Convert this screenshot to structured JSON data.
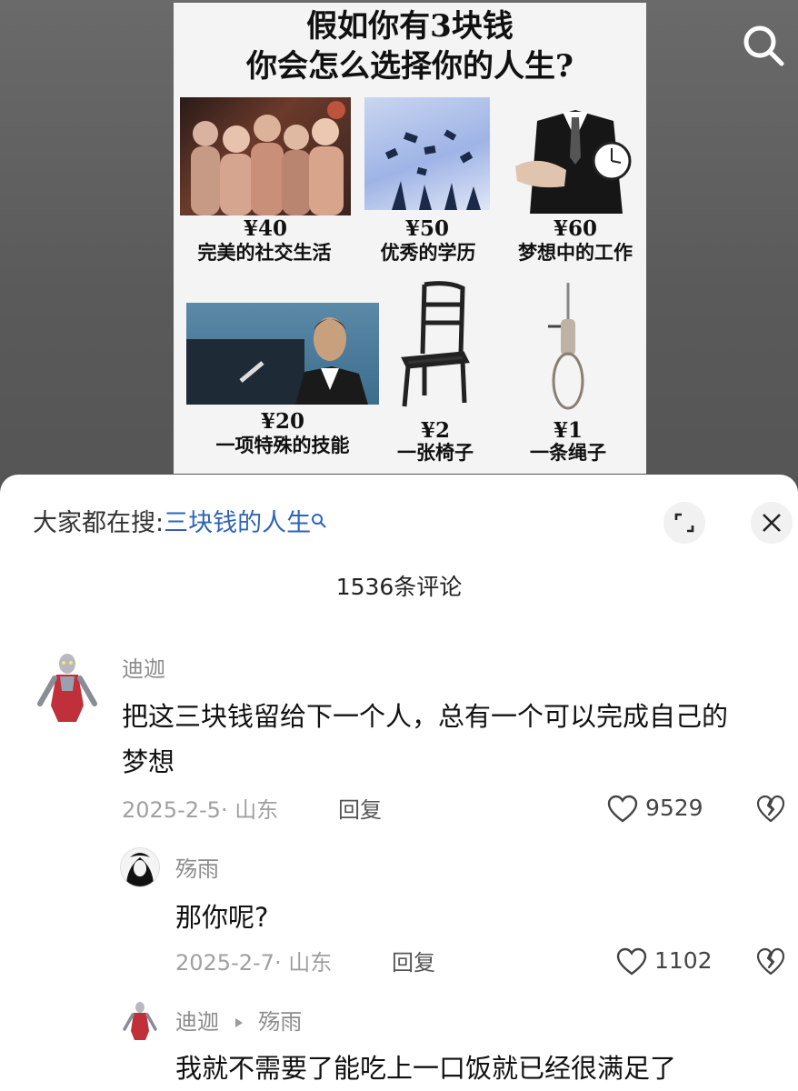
{
  "poster": {
    "title_line1": "假如你有3块钱",
    "title_line2": "你会怎么选择你的人生?",
    "items": [
      {
        "price": "¥40",
        "caption": "完美的社交生活"
      },
      {
        "price": "¥50",
        "caption": "优秀的学历"
      },
      {
        "price": "¥60",
        "caption": "梦想中的工作"
      },
      {
        "price": "¥20",
        "caption": "一项特殊的技能"
      },
      {
        "price": "¥2",
        "caption": "一张椅子"
      },
      {
        "price": "¥1",
        "caption": "一条绳子"
      }
    ]
  },
  "top_bar": {
    "search_icon": "search-icon"
  },
  "sheet": {
    "hot_search_prefix": "大家都在搜:",
    "hot_search_term": "三块钱的人生",
    "expand_icon": "expand-icon",
    "close_icon": "close-icon",
    "comment_count": "1536条评论"
  },
  "comments": [
    {
      "user": "迪迦",
      "text_line1": "把这三块钱留给下一个人，总有一个可以完成自己的",
      "text_line2": "梦想",
      "date": "2025-2-5",
      "location": "· 山东",
      "reply_label": "回复",
      "likes": "9529"
    },
    {
      "user": "殇雨",
      "text": "那你呢?",
      "date": "2025-2-7",
      "location": "· 山东",
      "reply_label": "回复",
      "likes": "1102"
    },
    {
      "user": "迪迦",
      "reply_to": "殇雨",
      "text": "我就不需要了能吃上一口饭就已经很满足了"
    }
  ],
  "colors": {
    "link_blue": "#2f63b8",
    "sheet_bg": "#ffffff",
    "backdrop": "#5d5d5d"
  }
}
